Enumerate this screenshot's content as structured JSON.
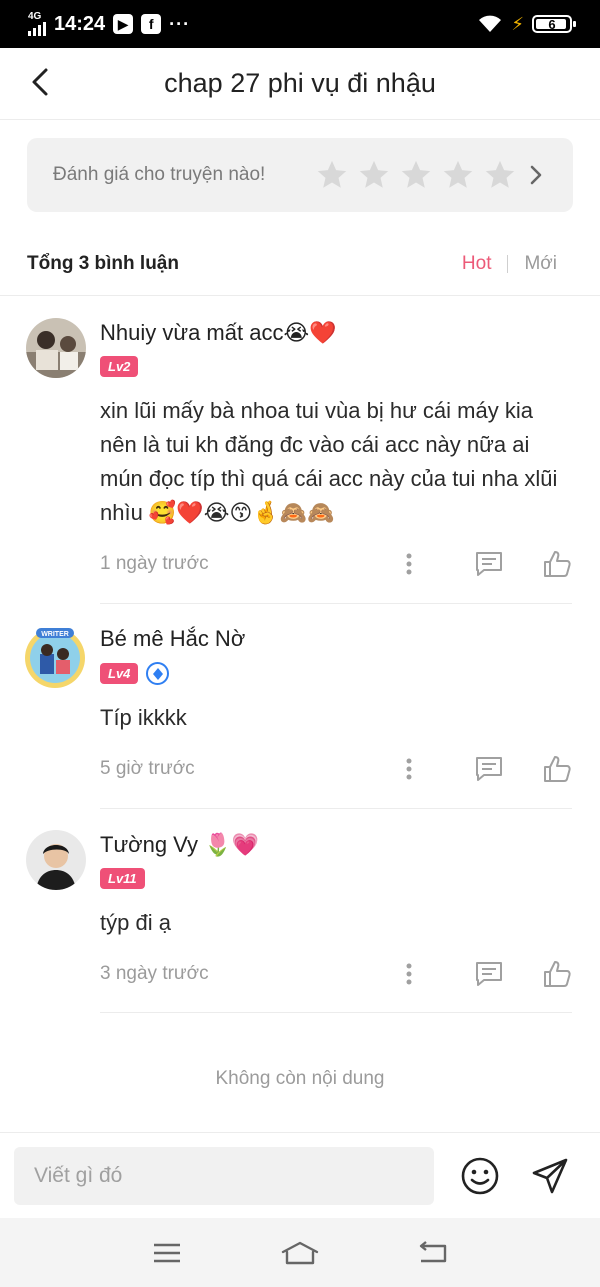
{
  "status_bar": {
    "network": "4G",
    "time": "14:24",
    "dots": "···",
    "battery": "6"
  },
  "header": {
    "title": "chap 27 phi vụ đi nhậu"
  },
  "rating": {
    "label": "Đánh giá cho truyện nào!",
    "stars": 5
  },
  "comments_header": {
    "count_label": "Tổng 3 bình luận",
    "tab_hot": "Hot",
    "tab_new": "Mới",
    "active_tab": "Hot"
  },
  "comments": [
    {
      "name": "Nhuiy vừa mất acc😭❤️",
      "level": "Lv2",
      "text": "xin lũi mấy bà nhoa tui vùa bị hư cái máy kia nên là tui kh đăng đc vào cái acc này nữa ai mún đọc típ thì quá cái acc này của tui nha xlũi nhìu 🥰❤️😭😙🤞🙈🙈",
      "time": "1 ngày trước"
    },
    {
      "name": "Bé mê Hắc Nờ",
      "level": "Lv4",
      "avatar_frame_label": "WRITER",
      "text": "Típ ikkkk",
      "time": "5 giờ trước"
    },
    {
      "name": "Tường Vy 🌷💗",
      "level": "Lv11",
      "text": "týp đi ạ",
      "time": "3 ngày trước"
    }
  ],
  "end_label": "Không còn nội dung",
  "composer": {
    "placeholder": "Viết gì đó"
  },
  "colors": {
    "accent": "#ef5077",
    "tab_hot": "#ec5a78",
    "muted": "#9b9b9b",
    "input_bg": "#f1f1f1"
  }
}
